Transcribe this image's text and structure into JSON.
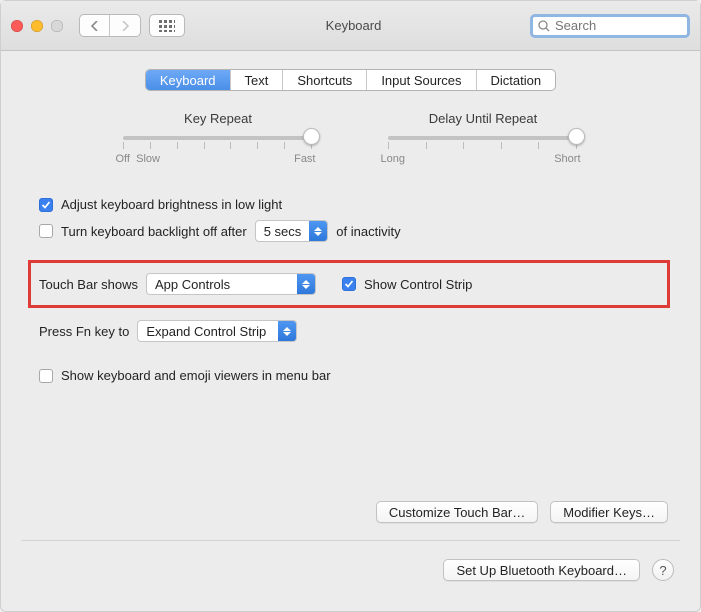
{
  "window": {
    "title": "Keyboard"
  },
  "search": {
    "placeholder": "Search",
    "value": ""
  },
  "tabs": [
    "Keyboard",
    "Text",
    "Shortcuts",
    "Input Sources",
    "Dictation"
  ],
  "active_tab_index": 0,
  "sliders": {
    "key_repeat": {
      "title": "Key Repeat",
      "left": "Off",
      "left2": "Slow",
      "right": "Fast",
      "tick_count": 8,
      "knob_index": 7
    },
    "delay_until_repeat": {
      "title": "Delay Until Repeat",
      "left": "Long",
      "right": "Short",
      "tick_count": 6,
      "knob_index": 5
    }
  },
  "options": {
    "adjust_brightness": {
      "checked": true,
      "label": "Adjust keyboard brightness in low light"
    },
    "backlight_off": {
      "checked": false,
      "label_a": "Turn keyboard backlight off after",
      "label_b": "of inactivity",
      "value": "5 secs"
    },
    "touch_bar_shows": {
      "label": "Touch Bar shows",
      "value": "App Controls"
    },
    "show_control_strip": {
      "checked": true,
      "label": "Show Control Strip"
    },
    "press_fn": {
      "label": "Press Fn key to",
      "value": "Expand Control Strip"
    },
    "show_viewers": {
      "checked": false,
      "label": "Show keyboard and emoji viewers in menu bar"
    }
  },
  "buttons": {
    "customize_touch_bar": "Customize Touch Bar…",
    "modifier_keys": "Modifier Keys…",
    "setup_bluetooth": "Set Up Bluetooth Keyboard…",
    "help": "?"
  }
}
